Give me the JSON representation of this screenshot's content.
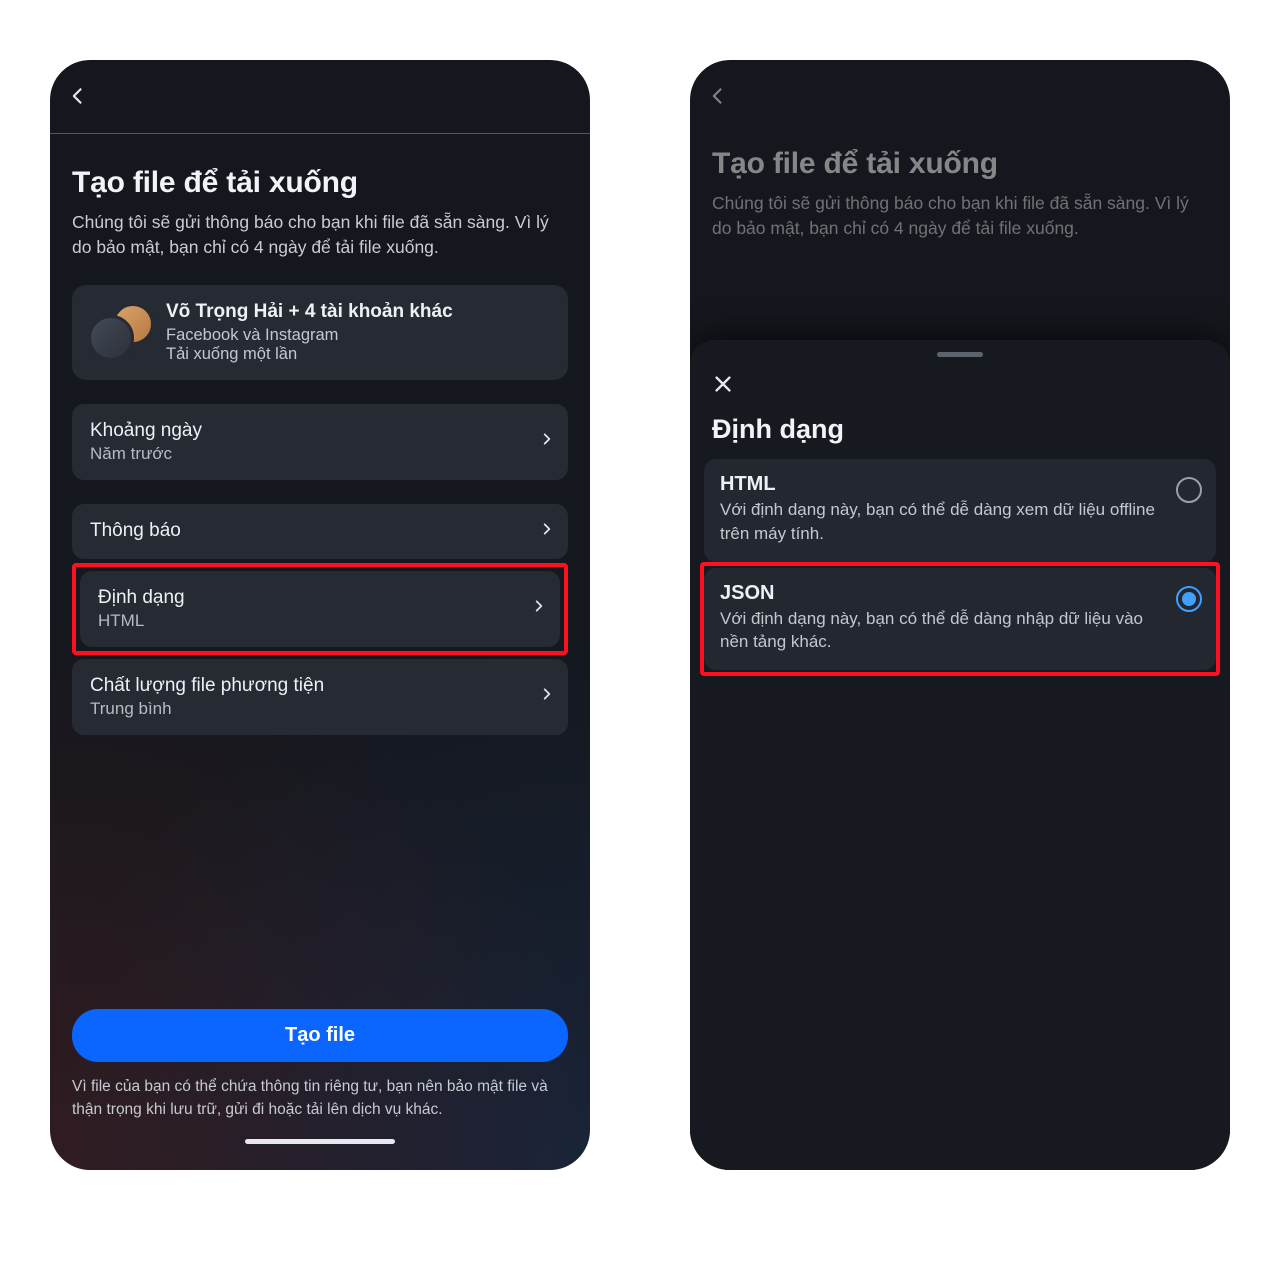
{
  "left": {
    "title": "Tạo file để tải xuống",
    "subtitle": "Chúng tôi sẽ gửi thông báo cho bạn khi file đã sẵn sàng. Vì lý do bảo mật, bạn chỉ có 4 ngày để tải file xuống.",
    "account": {
      "name": "Võ Trọng Hải + 4 tài khoản khác",
      "platforms": "Facebook và Instagram",
      "note": "Tải xuống một lần"
    },
    "rows": {
      "date_range": {
        "label": "Khoảng ngày",
        "value": "Năm trước"
      },
      "notify": {
        "label": "Thông báo"
      },
      "format": {
        "label": "Định dạng",
        "value": "HTML"
      },
      "quality": {
        "label": "Chất lượng file phương tiện",
        "value": "Trung bình"
      }
    },
    "cta": "Tạo file",
    "footer": "Vì file của bạn có thể chứa thông tin riêng tư, bạn nên bảo mật file và thận trọng khi lưu trữ, gửi đi hoặc tải lên dịch vụ khác."
  },
  "right": {
    "title": "Tạo file để tải xuống",
    "subtitle": "Chúng tôi sẽ gửi thông báo cho bạn khi file đã sẵn sàng. Vì lý do bảo mật, bạn chỉ có 4 ngày để tải file xuống.",
    "sheet_title": "Định dạng",
    "options": {
      "html": {
        "title": "HTML",
        "desc": "Với định dạng này, bạn có thể dễ dàng xem dữ liệu offline trên máy tính.",
        "selected": false
      },
      "json": {
        "title": "JSON",
        "desc": "Với định dạng này, bạn có thể dễ dàng nhập dữ liệu vào nền tảng khác.",
        "selected": true
      }
    }
  }
}
